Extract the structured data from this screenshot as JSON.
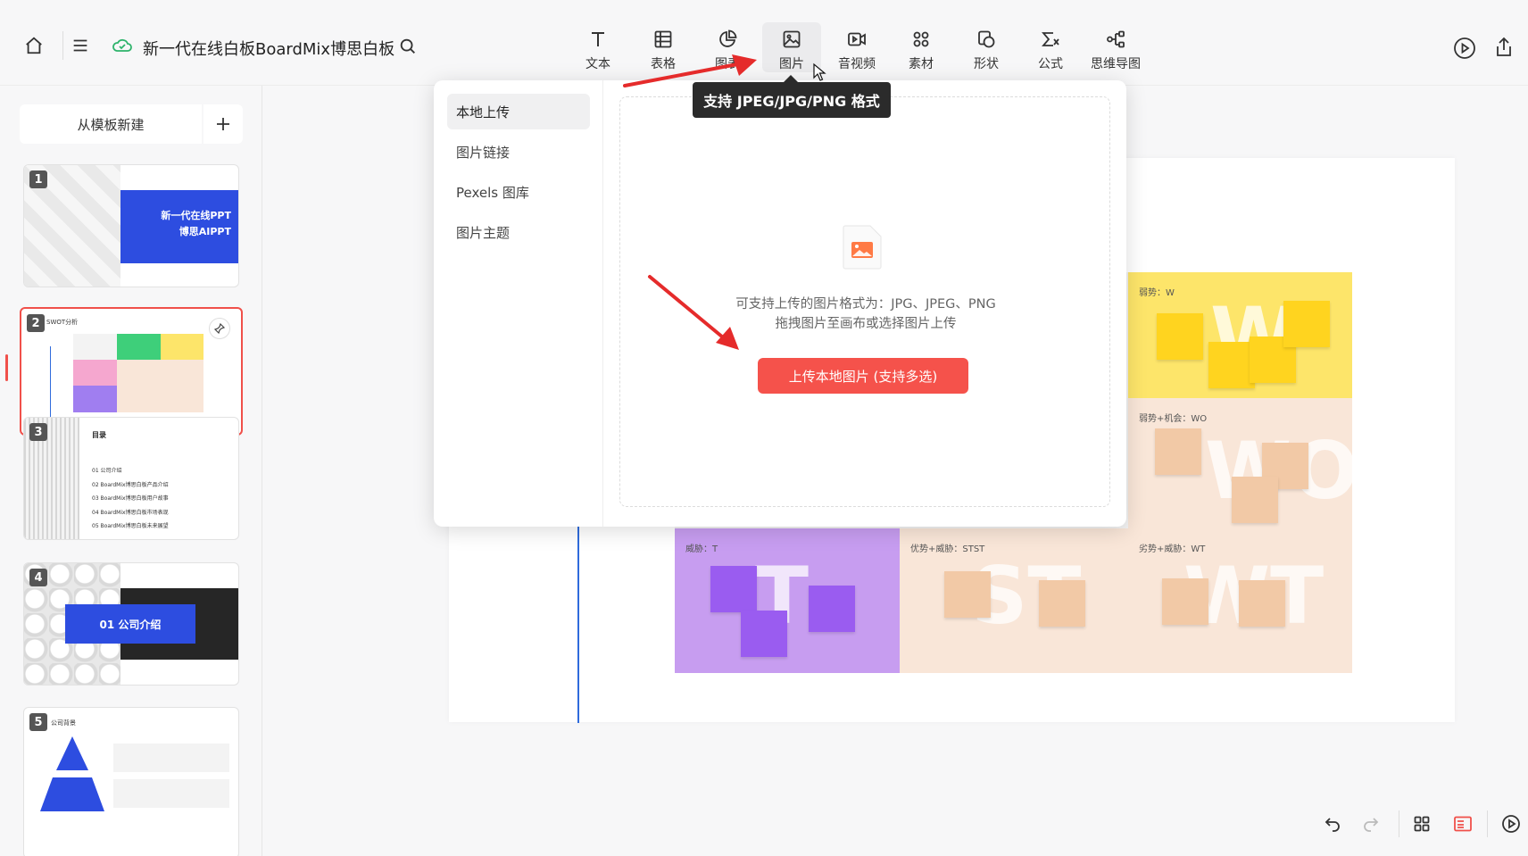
{
  "header": {
    "doc_title": "新一代在线白板BoardMix博思白板",
    "toolbar": [
      {
        "label": "文本",
        "icon": "text-icon"
      },
      {
        "label": "表格",
        "icon": "table-icon"
      },
      {
        "label": "图表",
        "icon": "chart-icon"
      },
      {
        "label": "图片",
        "icon": "image-icon"
      },
      {
        "label": "音视频",
        "icon": "video-icon"
      },
      {
        "label": "素材",
        "icon": "assets-icon"
      },
      {
        "label": "形状",
        "icon": "shape-icon"
      },
      {
        "label": "公式",
        "icon": "formula-icon"
      },
      {
        "label": "思维导图",
        "icon": "mindmap-icon"
      }
    ],
    "active_tool": "图片"
  },
  "sidebar": {
    "new_from_template": "从模板新建",
    "slides": [
      {
        "num": "1",
        "title": "新一代在线PPT",
        "subtitle": "博思AIPPT"
      },
      {
        "num": "2",
        "title": "SWOT分析"
      },
      {
        "num": "3",
        "title": "目录",
        "items": [
          "01  公司介绍",
          "02  BoardMix博思白板产品介绍",
          "03  BoardMix博思白板用户故事",
          "04  BoardMix博思白板市场表现",
          "05  BoardMix博思白板未来展望"
        ]
      },
      {
        "num": "4",
        "title": "01  公司介绍"
      },
      {
        "num": "5",
        "title": "公司背景"
      }
    ],
    "selected_slide": "2"
  },
  "tooltip": "支持 JPEG/JPG/PNG 格式",
  "image_modal": {
    "tabs": [
      "本地上传",
      "图片链接",
      "Pexels 图库",
      "图片主题"
    ],
    "active_tab": "本地上传",
    "hint_line1": "可支持上传的图片格式为：JPG、JPEG、PNG",
    "hint_line2": "拖拽图片至画布或选择图片上传",
    "upload_button": "上传本地图片 (支持多选)"
  },
  "swot": {
    "cells": [
      {
        "title": "弱势：W",
        "letter": "W",
        "color": "#fde56a"
      },
      {
        "title": "弱势+机会：WO",
        "letter": "WO",
        "color": "#f9e6d8"
      },
      {
        "title": "威胁：T",
        "letter": "T",
        "color": "#c79df0"
      },
      {
        "title": "优势+威胁：STST",
        "letter": "ST",
        "color": "#f9e6d8"
      },
      {
        "title": "劣势+威胁：WT",
        "letter": "WT",
        "color": "#f9e6d8"
      }
    ]
  },
  "colors": {
    "accent": "#f5524b",
    "tooltip_bg": "#2b2b2b",
    "selection": "#f0504a"
  }
}
